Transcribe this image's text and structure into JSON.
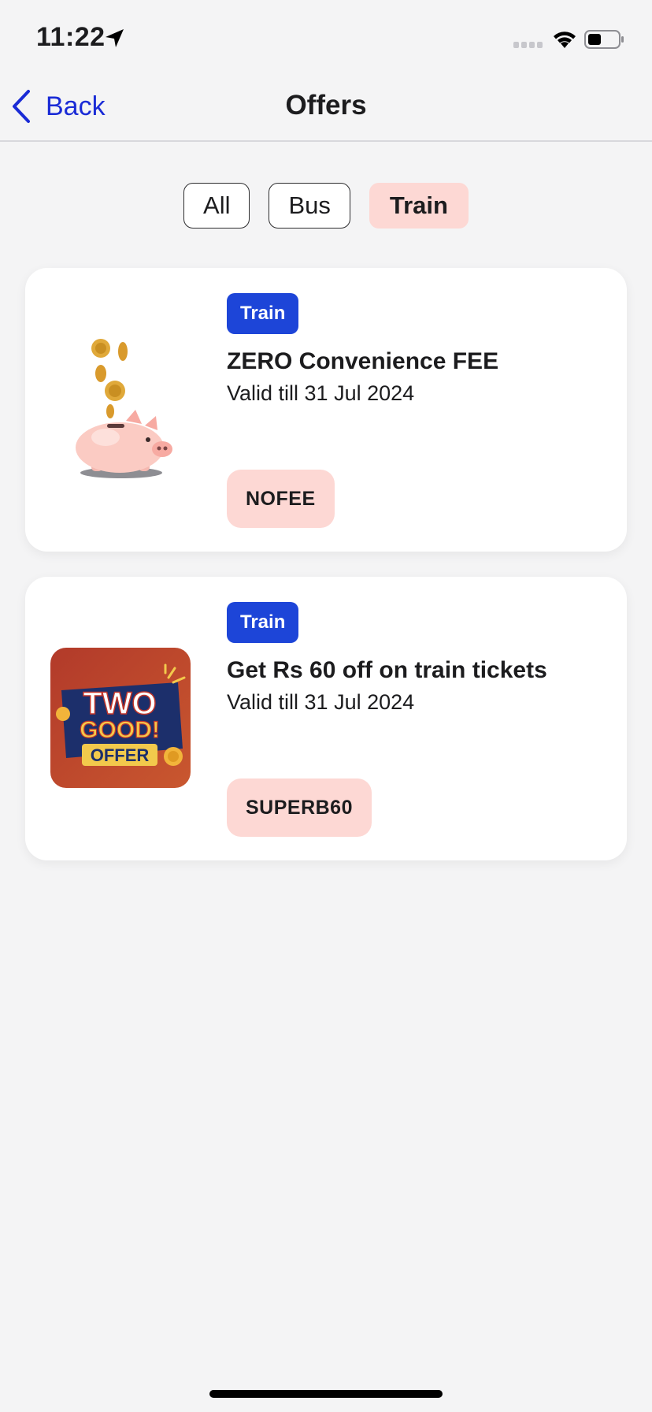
{
  "status_bar": {
    "time": "11:22"
  },
  "nav": {
    "back_label": "Back",
    "title": "Offers"
  },
  "filters": [
    {
      "label": "All",
      "active": false
    },
    {
      "label": "Bus",
      "active": false
    },
    {
      "label": "Train",
      "active": true
    }
  ],
  "offers": [
    {
      "badge": "Train",
      "title": "ZERO Convenience FEE",
      "valid": "Valid till 31 Jul 2024",
      "code": "NOFEE",
      "image_icon": "piggy-bank-coins"
    },
    {
      "badge": "Train",
      "title": "Get Rs 60 off on train tickets",
      "valid": "Valid till 31 Jul 2024",
      "code": "SUPERB60",
      "image_icon": "two-good-offer-logo",
      "image_text": [
        "TWO",
        "GOOD!",
        "OFFER"
      ]
    }
  ],
  "colors": {
    "accent_blue": "#1a2bd6",
    "badge_blue": "#1d45d8",
    "chip_active": "#fdd8d4",
    "code_bg": "#fdd8d4",
    "background": "#f4f4f5"
  }
}
